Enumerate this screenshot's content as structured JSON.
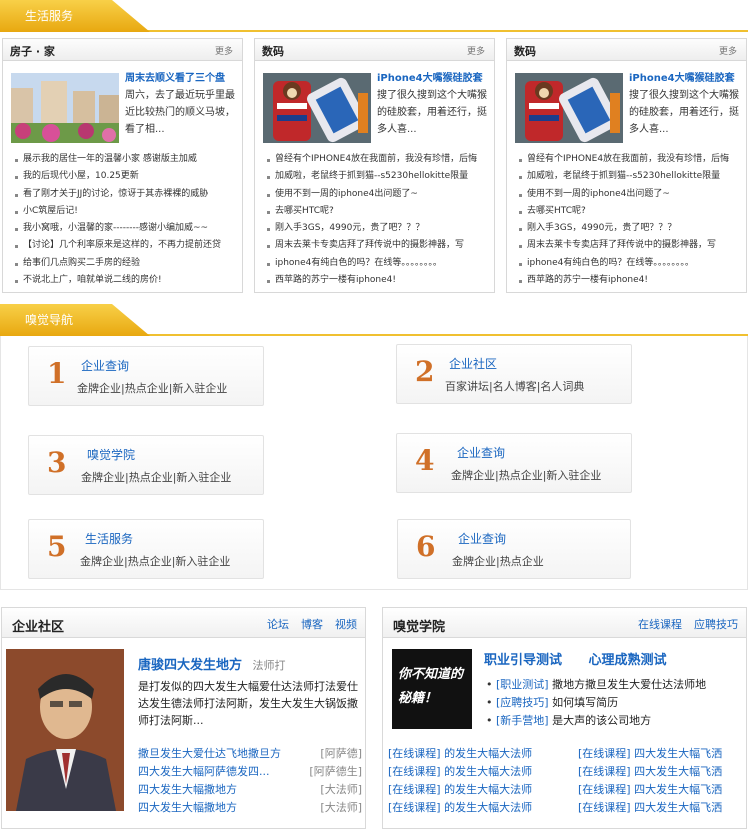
{
  "life": {
    "header": "生活服务",
    "panels": [
      {
        "title": "房子 · 家",
        "more": "更多",
        "feat_title": "周末去顺义看了三个盘",
        "feat_desc": "周六，去了最近玩乎里最近比较热门的顺义马坡，看了相...",
        "items": [
          "展示我的居住一年的温馨小家 感谢版主加威",
          "我的后现代小屋，10.25更新",
          "看了刚才关于JJ的讨论，惊讶于其赤裸裸的威胁",
          "小C筑屋后记!",
          "我小窝哦，小温馨的家--------感谢小编加威~~",
          "【讨论】几个利率原来是这样的，不再力提前还贷",
          "给事们几点购买二手房的经验",
          "不说北上广，咱就单说二线的房价!"
        ]
      },
      {
        "title": "数码",
        "more": "更多",
        "feat_title": "iPhone4大嘴猴硅胶套",
        "feat_desc": "搜了很久搜到这个大嘴猴的硅胶套，用着还行，挺多人喜...",
        "items": [
          "曾经有个IPHONE4放在我面前，我没有珍惜，后悔",
          "加威啦，老鼠终于抓到猫--s5230hellokitte限量",
          "使用不到一周的iphone4出问题了~",
          "去哪买HTC呢?",
          "刚入手3GS，4990元，贵了吧？？？",
          "周末去莱卡专卖店拜了拜传说中的摄影神器，写",
          "iphone4有纯白色的吗？在线等。。。。。。。。",
          "西苹路的苏宁一楼有iphone4!"
        ]
      },
      {
        "title": "数码",
        "more": "更多",
        "feat_title": "iPhone4大嘴猴硅胶套",
        "feat_desc": "搜了很久搜到这个大嘴猴的硅胶套，用着还行，挺多人喜...",
        "items": [
          "曾经有个IPHONE4放在我面前，我没有珍惜，后悔",
          "加威啦，老鼠终于抓到猫--s5230hellokitte限量",
          "使用不到一周的iphone4出问题了~",
          "去哪买HTC呢?",
          "刚入手3GS，4990元，贵了吧？？？",
          "周末去莱卡专卖店拜了拜传说中的摄影神器，写",
          "iphone4有纯白色的吗？在线等。。。。。。。。",
          "西苹路的苏宁一楼有iphone4!"
        ]
      }
    ]
  },
  "nav": {
    "header": "嗅觉导航",
    "items": [
      {
        "num": "1",
        "title": "企业查询",
        "links": "金牌企业|热点企业|新入驻企业"
      },
      {
        "num": "2",
        "title": "企业社区",
        "links": "百家讲坛|名人博客|名人词典"
      },
      {
        "num": "3",
        "title": "嗅觉学院",
        "links": "金牌企业|热点企业|新入驻企业"
      },
      {
        "num": "4",
        "title": "企业查询",
        "links": "金牌企业|热点企业|新入驻企业"
      },
      {
        "num": "5",
        "title": "生活服务",
        "links": "金牌企业|热点企业|新入驻企业"
      },
      {
        "num": "6",
        "title": "企业查询",
        "links": "金牌企业|热点企业"
      }
    ]
  },
  "community": {
    "title": "企业社区",
    "tabs": [
      "论坛",
      "博客",
      "视频"
    ],
    "person": "唐骏四大发生地方",
    "person_tag": "法师打",
    "desc": "是打发似的四大发生大幅爱仕达法师打法爱仕达发生德法师打法阿斯，发生大发生大锅饭撒师打法阿斯...",
    "links": [
      {
        "text": "撒旦发生大爱仕达飞地撒旦方",
        "tag": "[阿萨德]"
      },
      {
        "text": "四大发生大幅阿萨德发四...",
        "tag": "[阿萨德生]"
      },
      {
        "text": "四大发生大幅撒地方",
        "tag": "[大法师]"
      },
      {
        "text": "四大发生大幅撒地方",
        "tag": "[大法师]"
      }
    ]
  },
  "academy": {
    "title": "嗅觉学院",
    "tabs": [
      "在线课程",
      "应聘技巧"
    ],
    "banner": "你不知道的秘籍！",
    "heads": [
      "职业引导测试",
      "心理成熟测试"
    ],
    "items": [
      {
        "tag": "[职业测试]",
        "text": "撒地方撒旦发生大爱仕达法师地"
      },
      {
        "tag": "[应聘技巧]",
        "text": "如何填写简历"
      },
      {
        "tag": "[新手营地]",
        "text": "是大声的该公司地方"
      }
    ],
    "links": [
      "[在线课程] 的发生大幅大法师",
      "[在线课程] 四大发生大幅飞洒",
      "[在线课程] 的发生大幅大法师",
      "[在线课程] 四大发生大幅飞洒",
      "[在线课程] 的发生大幅大法师",
      "[在线课程] 四大发生大幅飞洒",
      "[在线课程] 的发生大幅大法师",
      "[在线课程] 四大发生大幅飞洒"
    ]
  }
}
